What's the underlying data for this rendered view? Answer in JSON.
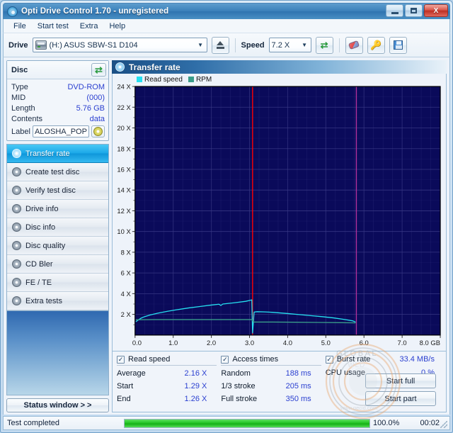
{
  "window": {
    "title": "Opti Drive Control 1.70 - unregistered",
    "icon": "disc-icon",
    "buttons": {
      "minimize": "minimize",
      "maximize": "maximize",
      "close": "X"
    }
  },
  "menu": {
    "items": [
      "File",
      "Start test",
      "Extra",
      "Help"
    ]
  },
  "toolbar": {
    "drive_label": "Drive",
    "drive_value": "(H:)   ASUS SBW-S1 D104",
    "eject_icon": "eject-icon",
    "speed_label": "Speed",
    "speed_value": "7.2 X",
    "refresh_icon": "refresh-icon",
    "eraser_icon": "eraser-icon",
    "key_icon": "key-icon",
    "save_icon": "save-icon"
  },
  "disc": {
    "header": "Disc",
    "refresh_icon": "refresh-icon",
    "rows": [
      {
        "key": "Type",
        "value": "DVD-ROM"
      },
      {
        "key": "MID",
        "value": "(000)"
      },
      {
        "key": "Length",
        "value": "5.76 GB"
      },
      {
        "key": "Contents",
        "value": "data"
      }
    ],
    "label_key": "Label",
    "label_value": "ALOSHA_POP",
    "disc_icon": "cd-disc-icon"
  },
  "sidebar": {
    "items": [
      {
        "label": "Transfer rate",
        "icon": "disc-icon",
        "active": true
      },
      {
        "label": "Create test disc",
        "icon": "disc-icon",
        "active": false
      },
      {
        "label": "Verify test disc",
        "icon": "disc-icon",
        "active": false
      },
      {
        "label": "Drive info",
        "icon": "disc-icon",
        "active": false
      },
      {
        "label": "Disc info",
        "icon": "disc-icon",
        "active": false
      },
      {
        "label": "Disc quality",
        "icon": "disc-icon",
        "active": false
      },
      {
        "label": "CD Bler",
        "icon": "disc-icon",
        "active": false
      },
      {
        "label": "FE / TE",
        "icon": "disc-icon",
        "active": false
      },
      {
        "label": "Extra tests",
        "icon": "disc-icon",
        "active": false
      }
    ],
    "status_button": "Status window > >"
  },
  "pane": {
    "title": "Transfer rate",
    "icon": "disc-icon"
  },
  "chart_data": {
    "type": "line",
    "title": "Transfer rate",
    "xlabel": "GB",
    "ylabel": "X",
    "xlim": [
      0.0,
      8.0
    ],
    "ylim": [
      0,
      24
    ],
    "xticks": [
      "0.0",
      "1.0",
      "2.0",
      "3.0",
      "4.0",
      "5.0",
      "6.0",
      "7.0",
      "8.0 GB"
    ],
    "xtick_values": [
      0,
      1,
      2,
      3,
      4,
      5,
      6,
      7,
      8
    ],
    "yticks": [
      "2 X",
      "4 X",
      "6 X",
      "8 X",
      "10 X",
      "12 X",
      "14 X",
      "16 X",
      "18 X",
      "20 X",
      "22 X",
      "24 X"
    ],
    "ytick_values": [
      2,
      4,
      6,
      8,
      10,
      12,
      14,
      16,
      18,
      20,
      22,
      24
    ],
    "grid": true,
    "legend_position": "top-left",
    "bgcolor": "#0a0a5a",
    "gridcolor": "#2b2b78",
    "series": [
      {
        "name": "Read speed",
        "color": "#25e0f0",
        "points": [
          [
            0.02,
            1.29
          ],
          [
            0.08,
            1.45
          ],
          [
            0.15,
            1.62
          ],
          [
            0.25,
            1.78
          ],
          [
            0.4,
            1.95
          ],
          [
            0.6,
            2.12
          ],
          [
            0.85,
            2.3
          ],
          [
            1.1,
            2.45
          ],
          [
            1.4,
            2.62
          ],
          [
            1.7,
            2.76
          ],
          [
            2.0,
            2.9
          ],
          [
            2.2,
            2.98
          ],
          [
            2.25,
            2.86
          ],
          [
            2.3,
            3.0
          ],
          [
            2.6,
            3.12
          ],
          [
            2.9,
            3.26
          ],
          [
            3.02,
            3.36
          ],
          [
            3.06,
            3.4
          ],
          [
            3.08,
            0.2
          ],
          [
            3.12,
            2.22
          ],
          [
            3.2,
            2.26
          ],
          [
            3.4,
            2.24
          ],
          [
            3.6,
            2.2
          ],
          [
            3.8,
            2.14
          ],
          [
            4.0,
            2.08
          ],
          [
            4.3,
            1.98
          ],
          [
            4.6,
            1.88
          ],
          [
            4.9,
            1.78
          ],
          [
            5.2,
            1.66
          ],
          [
            5.5,
            1.5
          ],
          [
            5.7,
            1.38
          ],
          [
            5.78,
            1.26
          ]
        ]
      },
      {
        "name": "RPM",
        "color": "#3a9d8a",
        "points": [
          [
            0.02,
            1.48
          ],
          [
            0.5,
            1.5
          ],
          [
            1.0,
            1.5
          ],
          [
            1.5,
            1.5
          ],
          [
            2.0,
            1.5
          ],
          [
            2.5,
            1.5
          ],
          [
            3.0,
            1.5
          ],
          [
            3.06,
            1.5
          ],
          [
            3.12,
            1.26
          ],
          [
            3.6,
            1.26
          ],
          [
            4.2,
            1.24
          ],
          [
            4.8,
            1.22
          ],
          [
            5.4,
            1.2
          ],
          [
            5.78,
            1.18
          ]
        ]
      }
    ],
    "markers": [
      {
        "x": 3.08,
        "color": "#ff0000",
        "name": "error-marker"
      },
      {
        "x": 5.8,
        "color": "#b0309a",
        "name": "end-marker"
      }
    ],
    "legend": [
      {
        "label": "Read speed",
        "color": "#25e0f0"
      },
      {
        "label": "RPM",
        "color": "#3a9d8a"
      }
    ]
  },
  "stats": {
    "read_speed": {
      "checkbox_label": "Read speed",
      "checked": true,
      "rows": [
        {
          "key": "Average",
          "value": "2.16 X"
        },
        {
          "key": "Start",
          "value": "1.29 X"
        },
        {
          "key": "End",
          "value": "1.26 X"
        }
      ]
    },
    "access_times": {
      "checkbox_label": "Access times",
      "checked": true,
      "rows": [
        {
          "key": "Random",
          "value": "188 ms"
        },
        {
          "key": "1/3 stroke",
          "value": "205 ms"
        },
        {
          "key": "Full stroke",
          "value": "350 ms"
        }
      ]
    },
    "burst": {
      "checkbox_label": "Burst rate",
      "checked": true,
      "burst_value": "33.4 MB/s",
      "cpu_key": "CPU usage",
      "cpu_value": "0 %",
      "start_full": "Start full",
      "start_part": "Start part"
    }
  },
  "statusbar": {
    "message": "Test completed",
    "percent": "100.0%",
    "time": "00:02",
    "progress": 100
  },
  "colors": {
    "accent": "#2a3fd0",
    "title_bar": "#3c81bb",
    "active_nav": "#1aa7e8",
    "progress": "#22c322",
    "chart_bg": "#0a0a5a",
    "read_speed": "#25e0f0",
    "rpm": "#3a9d8a"
  }
}
